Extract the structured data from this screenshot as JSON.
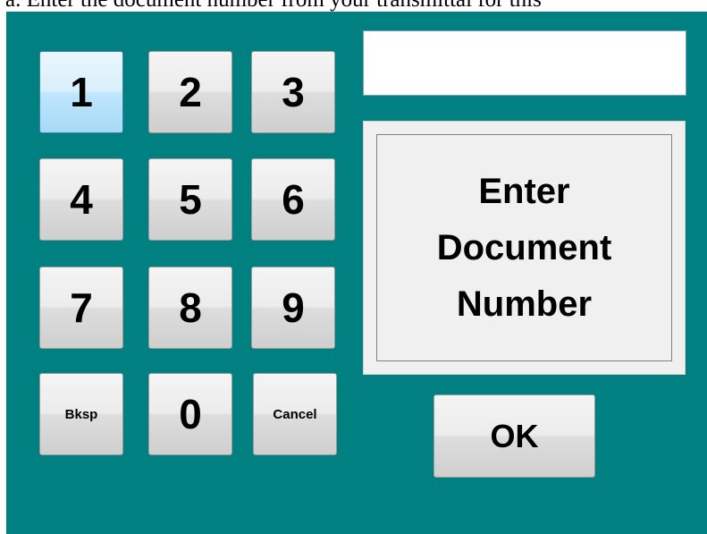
{
  "caption": "a.  Enter the document number from your transmittal for this",
  "display": {
    "value": ""
  },
  "keypad": {
    "keys": [
      "1",
      "2",
      "3",
      "4",
      "5",
      "6",
      "7",
      "8",
      "9",
      "Bksp",
      "0",
      "Cancel"
    ]
  },
  "prompt": {
    "lines": [
      "Enter",
      "Document",
      "Number"
    ]
  },
  "ok_label": "OK",
  "colors": {
    "panel": "#008080",
    "key_face": "#e6e6e6",
    "focus_border": "#3c7fb1"
  }
}
